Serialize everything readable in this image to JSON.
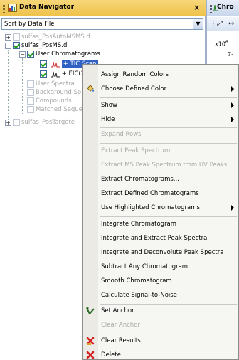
{
  "navigator": {
    "title": "Data Navigator",
    "close": "×",
    "sort_value": "Sort by Data File",
    "tree": [
      {
        "label": "sulfas_PosAutoMSMS.d",
        "expander": "+",
        "checked": false,
        "disabled": true
      },
      {
        "label": "sulfas_PosMS.d",
        "expander": "−",
        "checked": true,
        "disabled": false
      },
      {
        "label": "User Chromatograms",
        "expander": "−",
        "checked": true,
        "disabled": false
      },
      {
        "label": "+ TIC Scan",
        "checked": true,
        "selected": true
      },
      {
        "label": "+ EIC(2",
        "checked": true,
        "selected": false
      },
      {
        "label": "User Spectra",
        "checked": false,
        "disabled": true
      },
      {
        "label": "Background Sp",
        "checked": false,
        "disabled": true
      },
      {
        "label": "Compounds",
        "checked": false,
        "disabled": true
      },
      {
        "label": "Matched Seque",
        "checked": false,
        "disabled": true
      },
      {
        "label": "sulfas_PosTargete",
        "expander": "+",
        "checked": false,
        "disabled": true
      }
    ]
  },
  "right_panel": {
    "title": "Chro",
    "scale": "x10",
    "scale_exp": "6",
    "tick": "7-"
  },
  "menu": {
    "items": [
      {
        "label": "Assign Random Colors",
        "enabled": true
      },
      {
        "label": "Choose Defined Color",
        "enabled": true,
        "submenu": true,
        "icon": "paint-bucket-icon"
      },
      {
        "label": "Show",
        "enabled": true,
        "submenu": true
      },
      {
        "label": "Hide",
        "enabled": true,
        "submenu": true
      },
      {
        "label": "Expand Rows",
        "enabled": false
      },
      {
        "label": "Extract Peak Spectrum",
        "enabled": false
      },
      {
        "label": "Extract MS Peak Spectrum from UV Peaks",
        "enabled": false
      },
      {
        "label": "Extract Chromatograms...",
        "enabled": true
      },
      {
        "label": "Extract Defined Chromatograms",
        "enabled": true
      },
      {
        "label": "Use Highlighted Chromatograms",
        "enabled": true,
        "submenu": true
      },
      {
        "label": "Integrate Chromatogram",
        "enabled": true
      },
      {
        "label": "Integrate and Extract Peak Spectra",
        "enabled": true
      },
      {
        "label": "Integrate and Deconvolute Peak Spectra",
        "enabled": true
      },
      {
        "label": "Subtract Any Chromatogram",
        "enabled": true
      },
      {
        "label": "Smooth Chromatogram",
        "enabled": true
      },
      {
        "label": "Calculate Signal-to-Noise",
        "enabled": true
      },
      {
        "label": "Set Anchor",
        "enabled": true,
        "icon": "anchor-icon"
      },
      {
        "label": "Clear Anchor",
        "enabled": false
      },
      {
        "label": "Clear Results",
        "enabled": true,
        "icon": "clear-results-icon"
      },
      {
        "label": "Delete",
        "enabled": true,
        "icon": "delete-icon"
      }
    ]
  },
  "colors": {
    "title_bar": "#eec24a",
    "selection": "#3161c5",
    "check": "#1e9d1e",
    "delete_red": "#d42020"
  }
}
